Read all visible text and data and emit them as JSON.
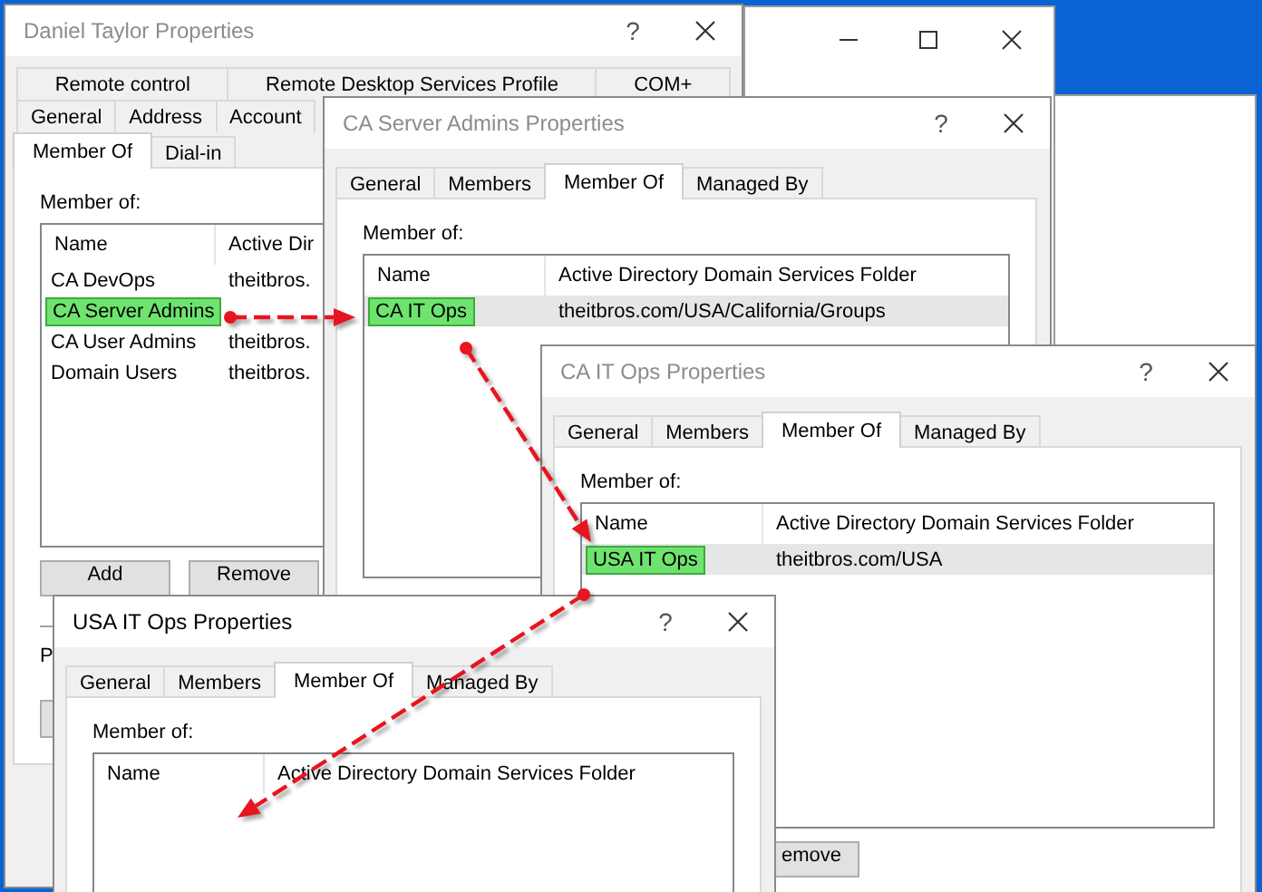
{
  "windows": [
    {
      "title": "Daniel Taylor Properties",
      "active": false,
      "help": "?",
      "tab_rows": [
        [
          {
            "label": "Remote control",
            "selected": false
          },
          {
            "label": "Remote Desktop Services Profile",
            "selected": false
          },
          {
            "label": "COM+",
            "selected": false
          }
        ],
        [
          {
            "label": "General",
            "selected": false
          },
          {
            "label": "Address",
            "selected": false
          },
          {
            "label": "Account",
            "selected": false
          }
        ],
        [
          {
            "label": "Member Of",
            "selected": true
          },
          {
            "label": "Dial-in",
            "selected": false
          }
        ]
      ],
      "list_label": "Member of:",
      "columns": [
        "Name",
        "Active Dir"
      ],
      "rows": [
        {
          "cells": [
            "CA DevOps",
            "theitbros."
          ],
          "selected": false,
          "highlighted": false
        },
        {
          "cells": [
            "CA Server Admins"
          ],
          "selected": false,
          "highlighted": true
        },
        {
          "cells": [
            "CA User Admins",
            "theitbros."
          ],
          "selected": false,
          "highlighted": false
        },
        {
          "cells": [
            "Domain Users",
            "theitbros."
          ],
          "selected": false,
          "highlighted": false
        }
      ],
      "buttons": [
        "Add",
        "Remove"
      ],
      "section_label": "P"
    },
    {
      "title": "CA Server Admins Properties",
      "active": false,
      "help": "?",
      "tab_rows": [
        [
          {
            "label": "General",
            "selected": false
          },
          {
            "label": "Members",
            "selected": false
          },
          {
            "label": "Member Of",
            "selected": true
          },
          {
            "label": "Managed By",
            "selected": false
          }
        ]
      ],
      "list_label": "Member of:",
      "columns": [
        "Name",
        "Active Directory Domain Services Folder"
      ],
      "rows": [
        {
          "cells": [
            "CA IT Ops",
            "theitbros.com/USA/California/Groups"
          ],
          "selected": true,
          "highlighted": true
        }
      ]
    },
    {
      "title": "CA IT Ops Properties",
      "active": false,
      "help": "?",
      "tab_rows": [
        [
          {
            "label": "General",
            "selected": false
          },
          {
            "label": "Members",
            "selected": false
          },
          {
            "label": "Member Of",
            "selected": true
          },
          {
            "label": "Managed By",
            "selected": false
          }
        ]
      ],
      "list_label": "Member of:",
      "columns": [
        "Name",
        "Active Directory Domain Services Folder"
      ],
      "rows": [
        {
          "cells": [
            "USA IT Ops",
            "theitbros.com/USA"
          ],
          "selected": true,
          "highlighted": true
        }
      ],
      "buttons": [
        "emove"
      ]
    },
    {
      "title": "USA IT Ops Properties",
      "active": true,
      "help": "?",
      "tab_rows": [
        [
          {
            "label": "General",
            "selected": false
          },
          {
            "label": "Members",
            "selected": false
          },
          {
            "label": "Member Of",
            "selected": true
          },
          {
            "label": "Managed By",
            "selected": false
          }
        ]
      ],
      "list_label": "Member of:",
      "columns": [
        "Name",
        "Active Directory Domain Services Folder"
      ]
    }
  ]
}
